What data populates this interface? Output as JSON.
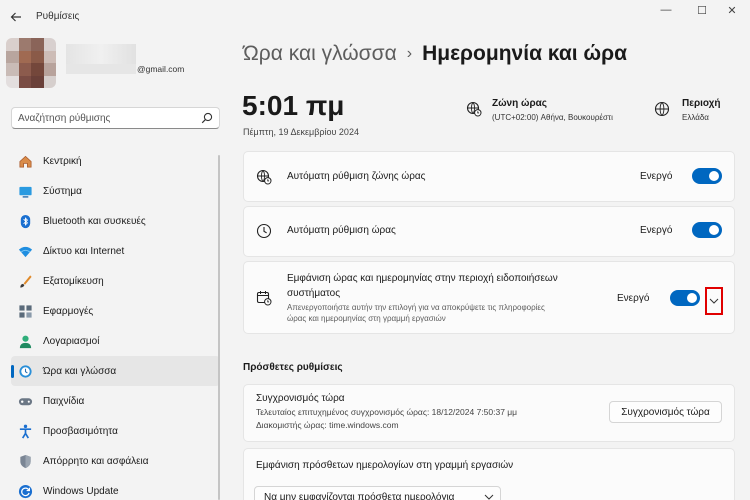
{
  "window": {
    "title": "Ρυθμίσεις",
    "minimize": "—",
    "maximize": "☐",
    "close": "✕"
  },
  "user": {
    "email_suffix": "@gmail.com"
  },
  "search": {
    "placeholder": "Αναζήτηση ρύθμισης"
  },
  "sidebar": {
    "items": [
      {
        "label": "Κεντρική",
        "icon": "home-icon"
      },
      {
        "label": "Σύστημα",
        "icon": "system-icon"
      },
      {
        "label": "Bluetooth και συσκευές",
        "icon": "bluetooth-icon"
      },
      {
        "label": "Δίκτυο και Internet",
        "icon": "network-icon"
      },
      {
        "label": "Εξατομίκευση",
        "icon": "brush-icon"
      },
      {
        "label": "Εφαρμογές",
        "icon": "apps-icon"
      },
      {
        "label": "Λογαριασμοί",
        "icon": "account-icon"
      },
      {
        "label": "Ώρα και γλώσσα",
        "icon": "time-language-icon",
        "active": true
      },
      {
        "label": "Παιχνίδια",
        "icon": "gaming-icon"
      },
      {
        "label": "Προσβασιμότητα",
        "icon": "accessibility-icon"
      },
      {
        "label": "Απόρρητο και ασφάλεια",
        "icon": "shield-icon"
      },
      {
        "label": "Windows Update",
        "icon": "update-icon"
      }
    ]
  },
  "breadcrumb": {
    "parent": "Ώρα και γλώσσα",
    "separator": "›",
    "current": "Ημερομηνία και ώρα"
  },
  "clock": {
    "time": "5:01 πμ",
    "date": "Πέμπτη, 19 Δεκεμβρίου 2024"
  },
  "timezone": {
    "label": "Ζώνη ώρας",
    "value": "(UTC+02:00) Αθήνα, Βουκουρέστι"
  },
  "region": {
    "label": "Περιοχή",
    "value": "Ελλάδα"
  },
  "settings": {
    "auto_timezone": {
      "label": "Αυτόματη ρύθμιση ζώνης ώρας",
      "state": "Ενεργό",
      "on": true
    },
    "auto_time": {
      "label": "Αυτόματη ρύθμιση ώρας",
      "state": "Ενεργό",
      "on": true
    },
    "show_in_tray": {
      "label_line1": "Εμφάνιση ώρας και ημερομηνίας στην περιοχή ειδοποιήσεων",
      "label_line2": "συστήματος",
      "desc_line1": "Απενεργοποιήστε αυτήν την επιλογή για να αποκρύψετε τις πληροφορίες",
      "desc_line2": "ώρας και ημερομηνίας στη γραμμή εργασιών",
      "state": "Ενεργό",
      "on": true
    }
  },
  "additional": {
    "title": "Πρόσθετες ρυθμίσεις",
    "sync": {
      "title": "Συγχρονισμός τώρα",
      "last_sync": "Τελευταίος επιτυχημένος συγχρονισμός ώρας: 18/12/2024 7:50:37 μμ",
      "server": "Διακομιστής ώρας: time.windows.com",
      "button": "Συγχρονισμός τώρα"
    },
    "calendars": {
      "title": "Εμφάνιση πρόσθετων ημερολογίων στη γραμμή εργασιών",
      "selected": "Να μην εμφανίζονται πρόσθετα ημερολόγια"
    }
  },
  "colors": {
    "accent": "#0067c0",
    "highlight": "#e00000"
  }
}
